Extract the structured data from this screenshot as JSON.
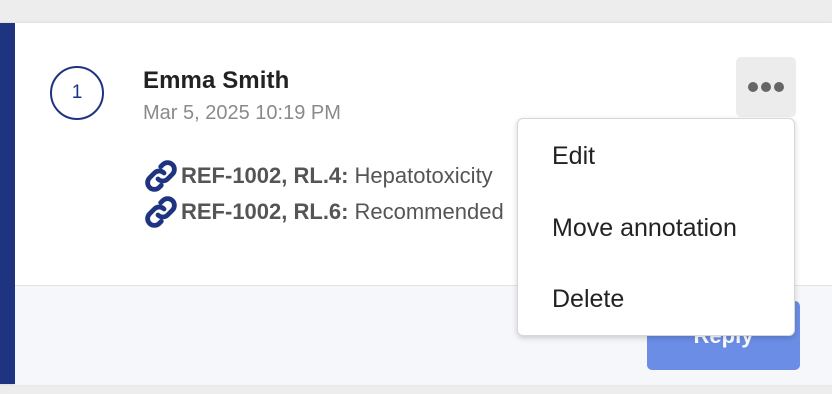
{
  "annotation": {
    "number": "1",
    "author": "Emma Smith",
    "timestamp": "Mar 5, 2025 10:19 PM",
    "references": [
      {
        "code": "REF-1002, RL.4:",
        "text": "Hepatotoxicity",
        "icon": "link-icon"
      },
      {
        "code": "REF-1002, RL.6:",
        "text": "Recommended",
        "icon": "link-icon"
      }
    ],
    "more_icon": "more-horizontal-icon"
  },
  "menu": {
    "items": [
      {
        "label": "Edit"
      },
      {
        "label": "Move annotation"
      },
      {
        "label": "Delete"
      }
    ]
  },
  "footer": {
    "reply_label": "Reply"
  },
  "colors": {
    "accent": "#1e3480",
    "reply_button": "#6b8de6",
    "timestamp": "#8a8a8a"
  }
}
